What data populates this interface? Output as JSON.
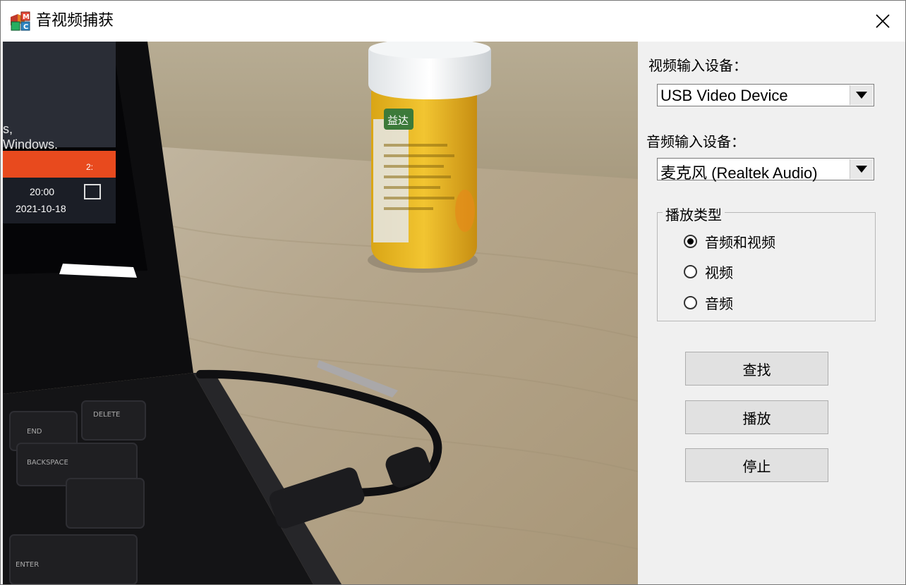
{
  "window": {
    "title": "音视频捕获"
  },
  "video_input": {
    "label": "视频输入设备：",
    "selected": "USB Video Device"
  },
  "audio_input": {
    "label": "音频输入设备：",
    "selected": "麦克风 (Realtek Audio)"
  },
  "play_type": {
    "title": "播放类型",
    "options": [
      {
        "label": "音频和视频",
        "checked": true
      },
      {
        "label": "视频",
        "checked": false
      },
      {
        "label": "音频",
        "checked": false
      }
    ]
  },
  "buttons": {
    "find": "查找",
    "play": "播放",
    "stop": "停止"
  },
  "preview": {
    "laptop_screen_lines": [
      "s,",
      "Windows.",
      "2:",
      "20:00",
      "2021-10-18"
    ],
    "key_labels": [
      "END",
      "DELETE",
      "BACKSPACE",
      "ENTER"
    ],
    "can_text": "益达"
  }
}
